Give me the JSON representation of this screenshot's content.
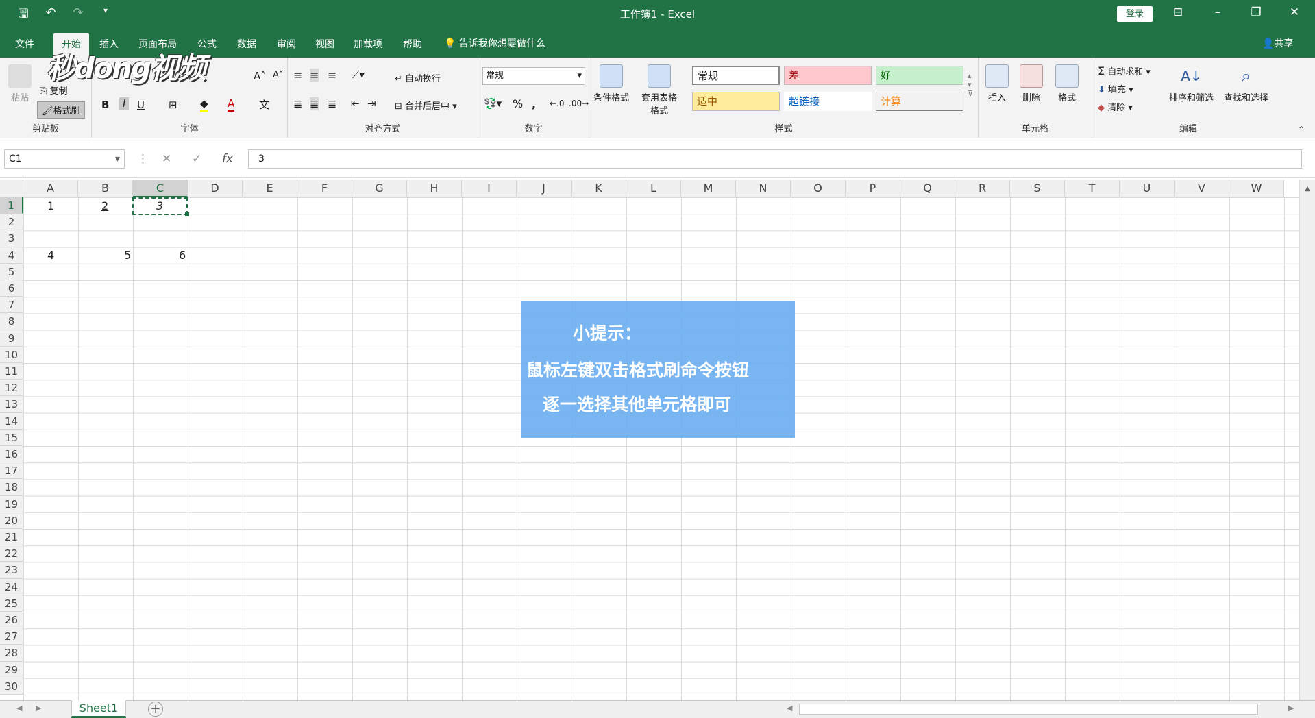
{
  "app": {
    "title": "工作簿1 - Excel",
    "login": "登录",
    "share": "共享",
    "tellme": "告诉我你想要做什么"
  },
  "colors": {
    "brand": "#217346",
    "tip_bg": "#6aaef0"
  },
  "qat": {
    "save_icon": "save-icon",
    "undo_icon": "undo-icon",
    "redo_icon": "redo-icon",
    "customize_icon": "customize-qat-icon"
  },
  "tabs": [
    "文件",
    "开始",
    "插入",
    "页面布局",
    "公式",
    "数据",
    "审阅",
    "视图",
    "加载项",
    "帮助"
  ],
  "ribbon": {
    "clipboard": {
      "label": "剪贴板",
      "paste": "粘贴",
      "copy": "复制",
      "format_painter": "格式刷"
    },
    "font": {
      "label": "字体",
      "bold": "B",
      "italic": "I",
      "underline": "U"
    },
    "alignment": {
      "label": "对齐方式",
      "wrap": "自动换行",
      "merge": "合并后居中"
    },
    "number": {
      "label": "数字",
      "format": "常规",
      "percent": "%",
      "comma": ","
    },
    "styles": {
      "label": "样式",
      "conditional": "条件格式",
      "table_format": "套用表格格式",
      "normal": "常规",
      "bad": "差",
      "good": "好",
      "neutral": "适中",
      "hyperlink": "超链接",
      "calc": "计算"
    },
    "cells": {
      "label": "单元格",
      "insert": "插入",
      "delete": "删除",
      "format": "格式"
    },
    "editing": {
      "label": "编辑",
      "autosum": "自动求和",
      "fill": "填充",
      "clear": "清除",
      "sort": "排序和筛选",
      "find": "查找和选择"
    }
  },
  "formula": {
    "namebox": "C1",
    "fx": "fx",
    "value": "3"
  },
  "columns": [
    "A",
    "B",
    "C",
    "D",
    "E",
    "F",
    "G",
    "H",
    "I",
    "J",
    "K",
    "L",
    "M",
    "N",
    "O",
    "P",
    "Q",
    "R",
    "S",
    "T",
    "U",
    "V",
    "W"
  ],
  "rows": [
    "1",
    "2",
    "3",
    "4",
    "5",
    "6",
    "7",
    "8",
    "9",
    "10",
    "11",
    "12",
    "13",
    "14",
    "15",
    "16",
    "17",
    "18",
    "19",
    "20",
    "21",
    "22",
    "23",
    "24",
    "25",
    "26",
    "27",
    "28",
    "29",
    "30"
  ],
  "cells": {
    "A1": "1",
    "B1": "2",
    "C1": "3",
    "A4": "4",
    "B4": "5",
    "C4": "6"
  },
  "tip": {
    "title": "小提示：",
    "line1": "鼠标左键双击格式刷命令按钮",
    "line2": "逐一选择其他单元格即可"
  },
  "watermark": "秒dong视频",
  "sheet": {
    "name": "Sheet1"
  }
}
